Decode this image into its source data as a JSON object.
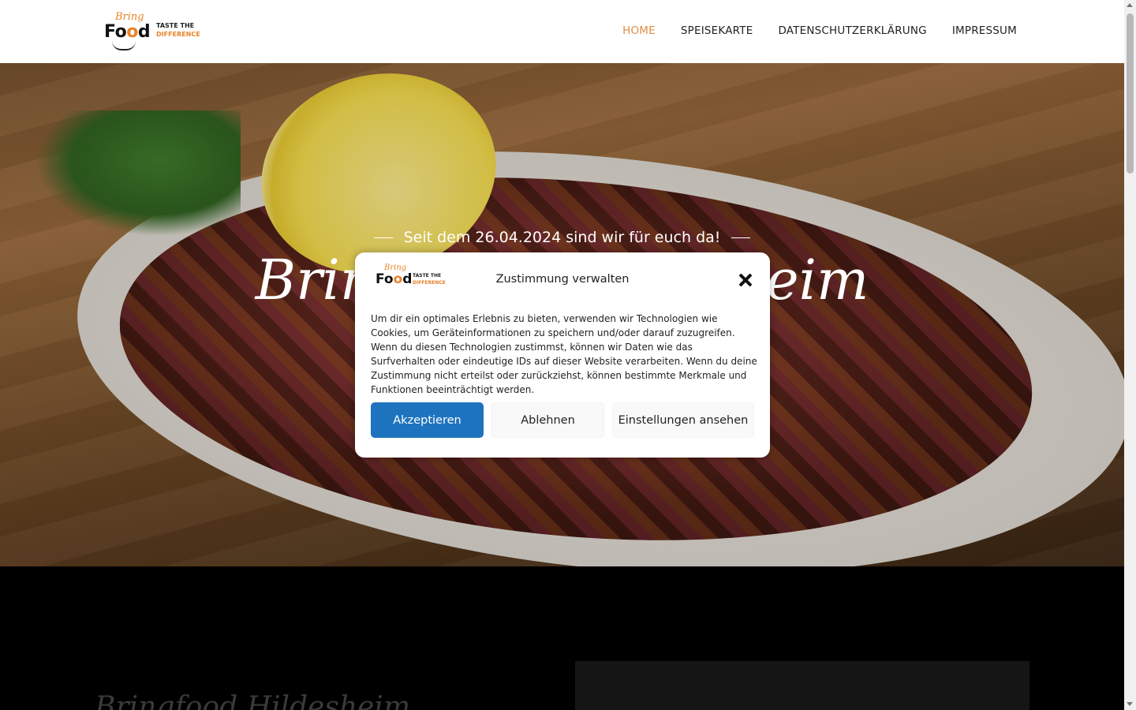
{
  "header": {
    "logo": {
      "word_top": "Bring",
      "word_main_1": "Fo",
      "word_main_2": "o",
      "word_main_3": "d",
      "tagline_1": "TASTE THE",
      "tagline_2": "DIFFERENCE"
    },
    "nav": [
      {
        "label": "HOME",
        "active": true
      },
      {
        "label": "SPEISEKARTE",
        "active": false
      },
      {
        "label": "DATENSCHUTZERKLÄRUNG",
        "active": false
      },
      {
        "label": "IMPRESSUM",
        "active": false
      }
    ],
    "accent_color": "#e08e45"
  },
  "hero": {
    "subtitle": "Seit dem 26.04.2024 sind wir für euch da!",
    "title": "Bringfood Hildesheim"
  },
  "section": {
    "title": "Bringfood Hildesheim"
  },
  "consent_modal": {
    "title": "Zustimmung verwalten",
    "text": "Um dir ein optimales Erlebnis zu bieten, verwenden wir Technologien wie Cookies, um Geräteinformationen zu speichern und/oder darauf zuzugreifen. Wenn du diesen Technologien zustimmst, können wir Daten wie das Surfverhalten oder eindeutige IDs auf dieser Website verarbeiten. Wenn du deine Zustimmung nicht erteilst oder zurückziehst, können bestimmte Merkmale und Funktionen beeinträchtigt werden.",
    "accept_label": "Akzeptieren",
    "deny_label": "Ablehnen",
    "settings_label": "Einstellungen ansehen",
    "primary_color": "#1e73be",
    "close_icon": "close-icon"
  }
}
